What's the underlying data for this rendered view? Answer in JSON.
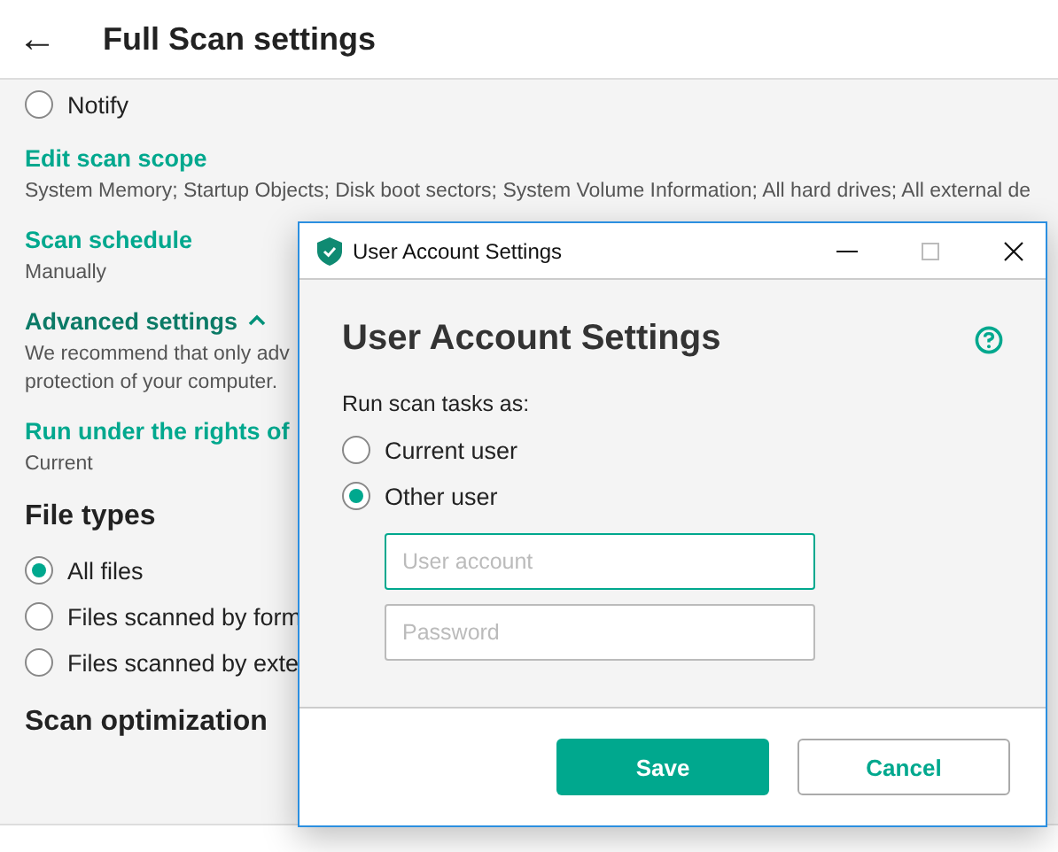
{
  "header": {
    "back": "←",
    "title": "Full Scan settings"
  },
  "notify": {
    "label": "Notify",
    "selected": false
  },
  "sections": [
    {
      "title": "Edit scan scope",
      "lines": [
        "System Memory; Startup Objects; Disk boot sectors; System Volume Information; All hard drives; All external de"
      ]
    },
    {
      "title": "Scan schedule",
      "lines": [
        "Manually"
      ]
    },
    {
      "title": "Advanced settings",
      "expanded": true,
      "dark": true,
      "lines": [
        "We recommend that only adv",
        "protection of your computer."
      ]
    },
    {
      "title": "Run under the rights of",
      "lines": [
        "Current"
      ]
    }
  ],
  "file_types": {
    "title": "File types",
    "options": [
      {
        "label": "All files",
        "selected": true
      },
      {
        "label": "Files scanned by form",
        "selected": false
      },
      {
        "label": "Files scanned by exte",
        "selected": false
      }
    ]
  },
  "next_section": "Scan optimization",
  "dialog": {
    "window_title": "User Account Settings",
    "heading": "User Account Settings",
    "prompt": "Run scan tasks as:",
    "options": [
      {
        "label": "Current user",
        "selected": false
      },
      {
        "label": "Other user",
        "selected": true
      }
    ],
    "fields": [
      {
        "placeholder": "User account",
        "focused": true
      },
      {
        "placeholder": "Password",
        "focused": false
      }
    ],
    "save": "Save",
    "cancel": "Cancel"
  }
}
